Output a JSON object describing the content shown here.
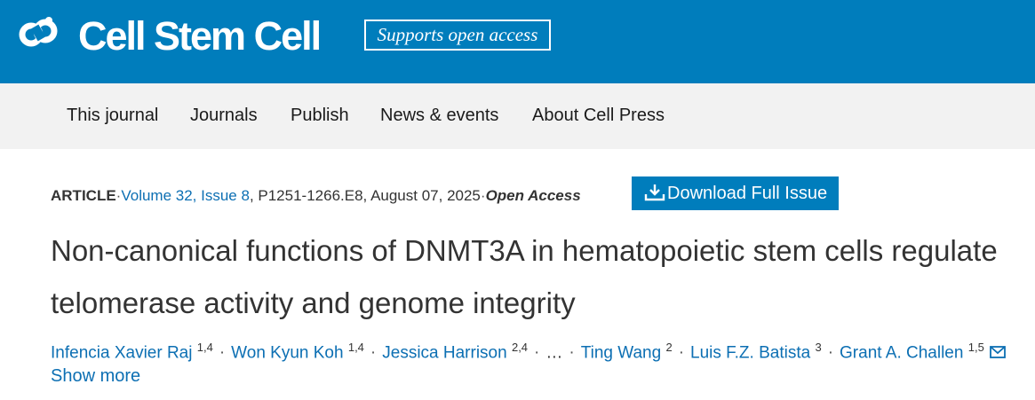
{
  "header": {
    "journal_name": "Cell Stem Cell",
    "badge": "Supports open access",
    "brand_color": "#007dbc",
    "logo_icon": "cell-press-logo-icon"
  },
  "nav": {
    "items": [
      "This journal",
      "Journals",
      "Publish",
      "News & events",
      "About Cell Press"
    ]
  },
  "article": {
    "type": "ARTICLE",
    "volume_issue": "Volume 32, Issue 8",
    "pages": "P1251-1266.E8",
    "date": "August 07, 2025",
    "access": "Open Access",
    "download_label": "Download Full Issue",
    "download_icon": "download-icon",
    "title": "Non-canonical functions of DNMT3A in hematopoietic stem cells regulate telomerase activity and genome integrity",
    "authors": [
      {
        "name": "Infencia Xavier Raj",
        "aff": "1,4"
      },
      {
        "name": "Won Kyun Koh",
        "aff": "1,4"
      },
      {
        "name": "Jessica Harrison",
        "aff": "2,4"
      },
      {
        "name": "Ting Wang",
        "aff": "2"
      },
      {
        "name": "Luis F.Z. Batista",
        "aff": "3"
      },
      {
        "name": "Grant A. Challen",
        "aff": "1,5"
      }
    ],
    "ellipsis": "…",
    "mail_icon": "envelope-icon",
    "show_more": "Show more"
  }
}
